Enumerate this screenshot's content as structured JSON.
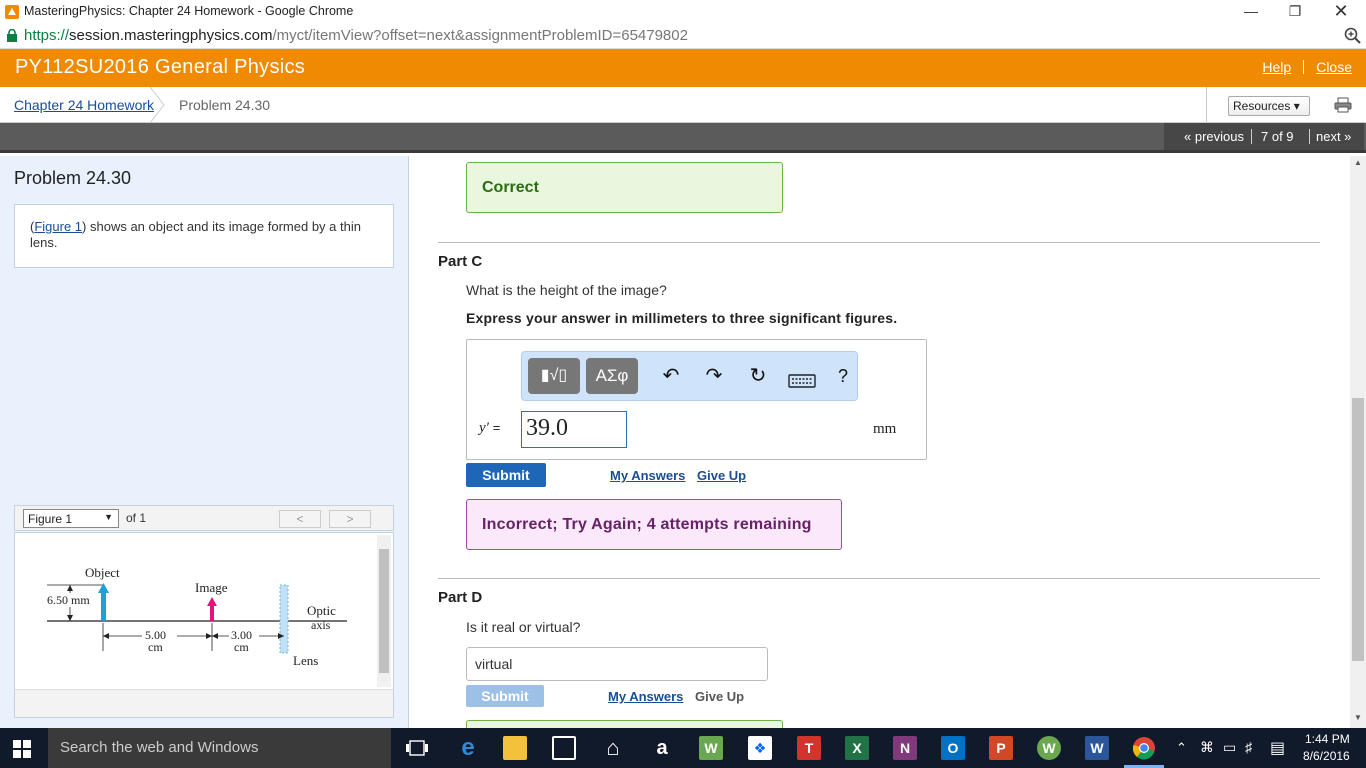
{
  "browser": {
    "tab_title": "MasteringPhysics: Chapter 24 Homework - Google Chrome",
    "url_scheme": "https://",
    "url_host": "session.masteringphysics.com",
    "url_path": "/myct/itemView?offset=next&assignmentProblemID=65479802"
  },
  "header": {
    "course_title": "PY112SU2016 General Physics",
    "help_label": "Help",
    "close_label": "Close"
  },
  "breadcrumb": {
    "assignment": "Chapter 24 Homework",
    "problem": "Problem 24.30",
    "resources_label": "Resources ▾"
  },
  "nav": {
    "previous_label": "« previous",
    "position": "7 of 9",
    "next_label": "next »"
  },
  "left": {
    "problem_title": "Problem 24.30",
    "intro_open": "(",
    "figure_link": "Figure 1",
    "intro_rest": ") shows an object and its image formed by a thin lens.",
    "figure_select": "Figure 1",
    "figure_of": "of 1",
    "figure": {
      "object_label": "Object",
      "image_label": "Image",
      "object_height": "6.50 mm",
      "optic_axis_1": "Optic",
      "optic_axis_2": "axis",
      "dist1_value": "5.00",
      "dist1_unit": "cm",
      "dist2_value": "3.00",
      "dist2_unit": "cm",
      "lens_label": "Lens"
    }
  },
  "main": {
    "correct_label": "Correct",
    "part_c": {
      "title": "Part C",
      "question": "What is the height of the image?",
      "instruction": "Express your answer in millimeters to three significant figures.",
      "template_icon": "▮√▯",
      "greek_icon": "ΑΣφ",
      "help_icon": "?",
      "variable": "y′",
      "equals": "=",
      "answer_value": "39.0",
      "unit": "mm",
      "submit_label": "Submit",
      "my_answers_label": "My Answers",
      "give_up_label": "Give Up",
      "feedback": "Incorrect; Try Again; 4 attempts remaining"
    },
    "part_d": {
      "title": "Part D",
      "question": "Is it real or virtual?",
      "answer_value": "virtual",
      "submit_label": "Submit",
      "my_answers_label": "My Answers",
      "give_up_label": "Give Up"
    }
  },
  "taskbar": {
    "search_placeholder": "Search the web and Windows",
    "time": "1:44 PM",
    "date": "8/6/2016"
  },
  "colors": {
    "header_orange": "#f08a00",
    "submit_blue": "#1e66b8",
    "submit_disabled": "#9cc0e6",
    "correct_green": "#6bb347",
    "incorrect_purple": "#a14ba1"
  }
}
